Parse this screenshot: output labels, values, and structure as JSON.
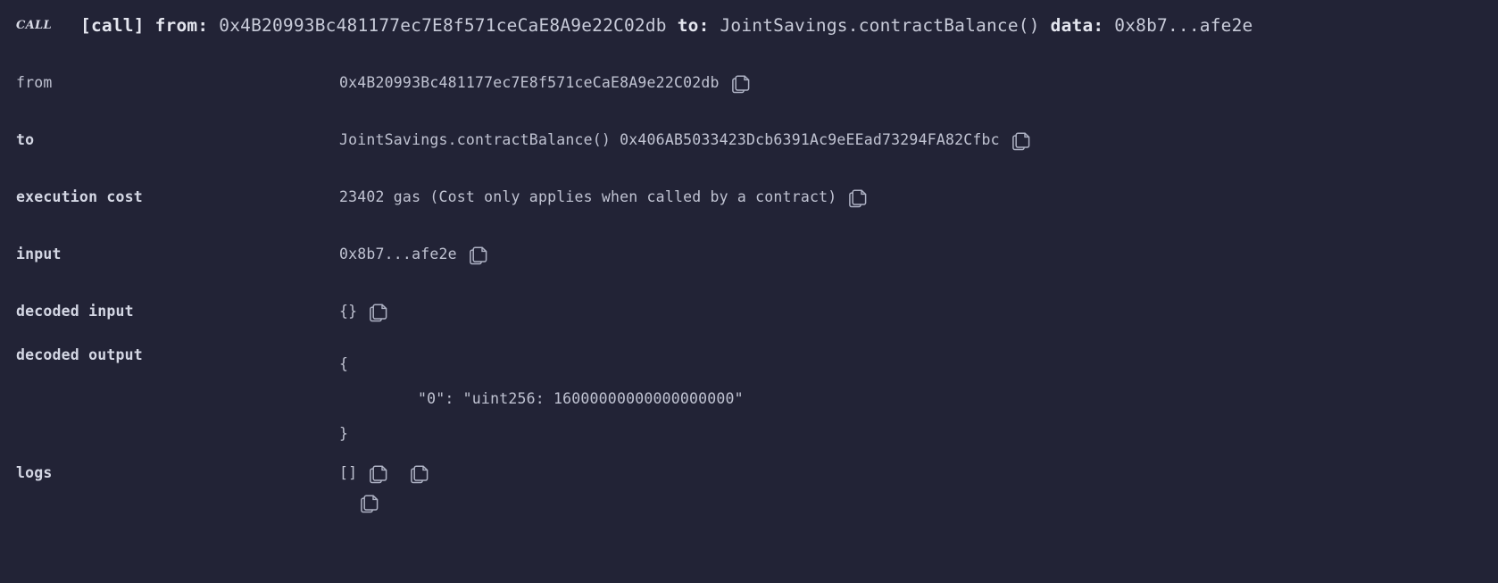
{
  "theme": {
    "background": "#222336",
    "text": "#c0c3d2",
    "text_bold": "#d4d7e4",
    "icon": "#aeb2c4"
  },
  "call_line": {
    "badge": "CALL",
    "label_call": "[call]",
    "label_from": "from:",
    "from_value": "0x4B20993Bc481177ec7E8f571ceCaE8A9e22C02db",
    "label_to": "to:",
    "to_value": "JointSavings.contractBalance()",
    "label_data": "data:",
    "data_value": "0x8b7...afe2e"
  },
  "rows": [
    {
      "key": "from",
      "key_bold": false,
      "value": "0x4B20993Bc481177ec7E8f571ceCaE8A9e22C02db",
      "copy": "copy-icon"
    },
    {
      "key": "to",
      "key_bold": true,
      "value": "JointSavings.contractBalance() 0x406AB5033423Dcb6391Ac9eEEad73294FA82Cfbc",
      "copy": "copy-icon"
    },
    {
      "key": "execution cost",
      "key_bold": true,
      "value": "23402 gas (Cost only applies when called by a contract)",
      "copy": "copy-icon"
    },
    {
      "key": "input",
      "key_bold": true,
      "value": "0x8b7...afe2e",
      "copy": "copy-icon"
    },
    {
      "key": "decoded input",
      "key_bold": true,
      "value": "{}",
      "copy": "copy-icon"
    }
  ],
  "decoded_output": {
    "key": "decoded output",
    "line_open": "{",
    "line_entry": "\"0\": \"uint256: 16000000000000000000\"",
    "line_close": "}",
    "copy": "copy-icon"
  },
  "logs_row": {
    "key": "logs",
    "value": "[]",
    "copy_1": "copy-icon",
    "copy_2": "copy-icon"
  }
}
